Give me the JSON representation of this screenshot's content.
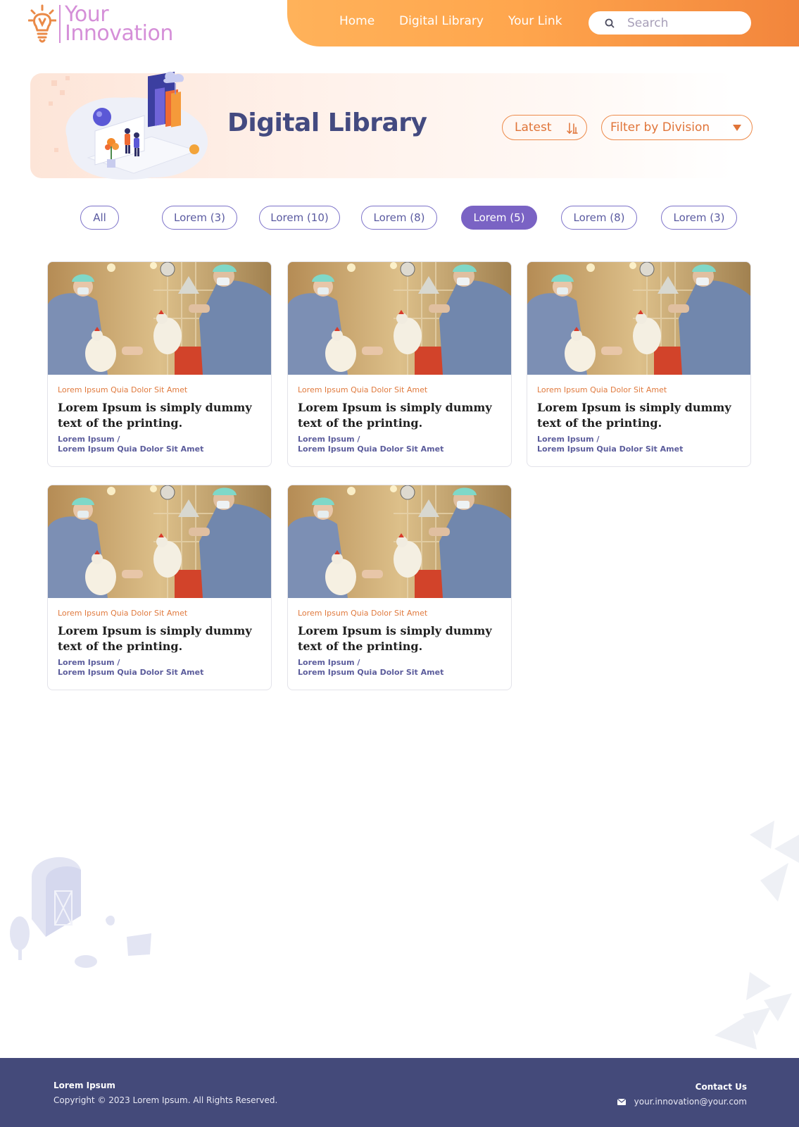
{
  "brand": {
    "line1": "Your",
    "line2": "Innovation"
  },
  "nav": {
    "items": [
      {
        "label": "Home"
      },
      {
        "label": "Digital Library"
      },
      {
        "label": "Your Link"
      }
    ],
    "search": {
      "placeholder": "Search",
      "icon": "search-icon"
    }
  },
  "banner": {
    "title": "Digital Library",
    "sort": {
      "label": "Latest",
      "icon": "sort-descending-icon"
    },
    "division": {
      "label": "Filter by Division",
      "icon": "caret-down-icon"
    }
  },
  "filters": [
    {
      "label": "All",
      "active": false
    },
    {
      "label": "Lorem (3)",
      "active": false
    },
    {
      "label": "Lorem (10)",
      "active": false
    },
    {
      "label": "Lorem (8)",
      "active": false
    },
    {
      "label": "Lorem (5)",
      "active": true
    },
    {
      "label": "Lorem (8)",
      "active": false
    },
    {
      "label": "Lorem (3)",
      "active": false
    }
  ],
  "cards": [
    {
      "kicker": "Lorem Ipsum Quia Dolor Sit Amet",
      "title": "Lorem Ipsum is simply dummy text of the printing.",
      "meta1": "Lorem Ipsum /",
      "meta2": "Lorem Ipsum Quia Dolor Sit Amet"
    },
    {
      "kicker": "Lorem Ipsum Quia Dolor Sit Amet",
      "title": "Lorem Ipsum is simply dummy text of the printing.",
      "meta1": "Lorem Ipsum /",
      "meta2": "Lorem Ipsum Quia Dolor Sit Amet"
    },
    {
      "kicker": "Lorem Ipsum Quia Dolor Sit Amet",
      "title": "Lorem Ipsum is simply dummy text of the printing.",
      "meta1": "Lorem Ipsum /",
      "meta2": "Lorem Ipsum Quia Dolor Sit Amet"
    },
    {
      "kicker": "Lorem Ipsum Quia Dolor Sit Amet",
      "title": "Lorem Ipsum is simply dummy text of the printing.",
      "meta1": "Lorem Ipsum /",
      "meta2": "Lorem Ipsum Quia Dolor Sit Amet"
    },
    {
      "kicker": "Lorem Ipsum Quia Dolor Sit Amet",
      "title": "Lorem Ipsum is simply dummy text of the printing.",
      "meta1": "Lorem Ipsum /",
      "meta2": "Lorem Ipsum Quia Dolor Sit Amet"
    }
  ],
  "footer": {
    "brand": "Lorem Ipsum",
    "copyright": "Copyright © 2023 Lorem Ipsum. All Rights Reserved.",
    "contact_label": "Contact Us",
    "email": "your.innovation@your.com",
    "email_icon": "mail-icon"
  },
  "colors": {
    "accent_orange": "#f2853c",
    "brand_pink": "#d58fd8",
    "title_navy": "#434a80",
    "chip_purple": "#7a63c4",
    "footer_bg": "#444a7a"
  }
}
